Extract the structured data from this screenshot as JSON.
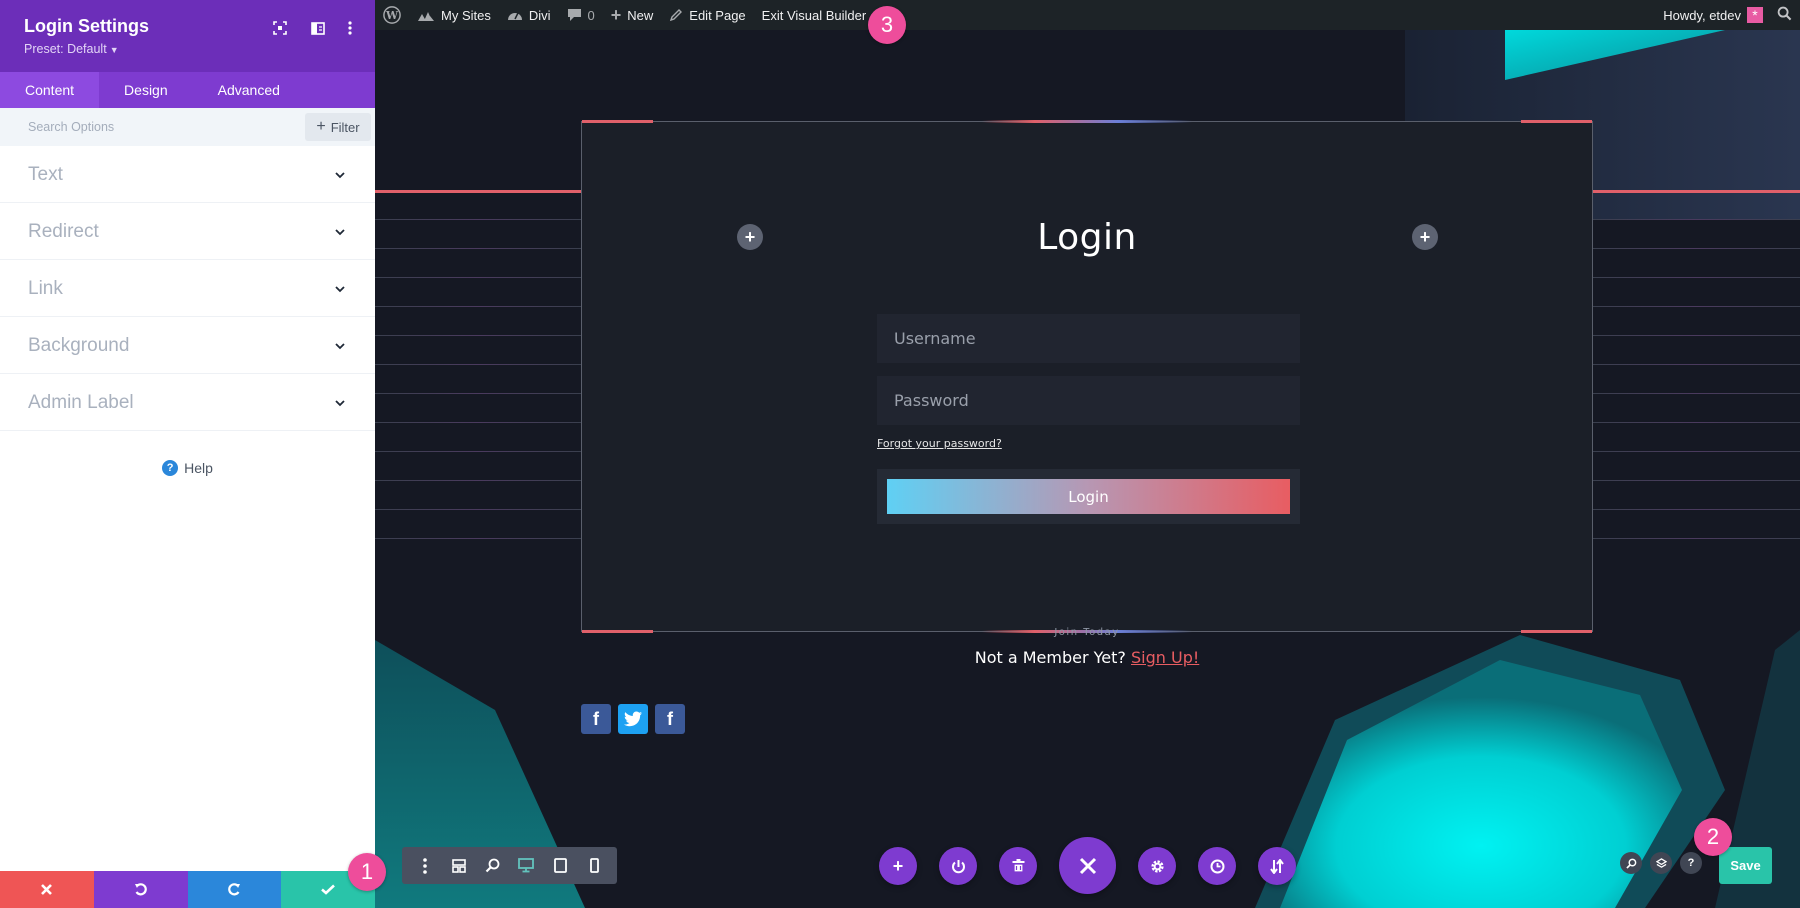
{
  "panel": {
    "title": "Login Settings",
    "preset": "Preset: Default",
    "tabs": [
      {
        "label": "Content",
        "active": true
      },
      {
        "label": "Design",
        "active": false
      },
      {
        "label": "Advanced",
        "active": false
      }
    ],
    "search_placeholder": "Search Options",
    "filter_label": "Filter",
    "toggles": [
      "Text",
      "Redirect",
      "Link",
      "Background",
      "Admin Label"
    ],
    "help_label": "Help",
    "footer_colors": {
      "discard": "#ef5555",
      "undo": "#7e3bd0",
      "redo": "#2b87da",
      "save": "#29c4a9"
    }
  },
  "adminbar": {
    "my_sites": "My Sites",
    "divi": "Divi",
    "comments_count": "0",
    "new": "New",
    "edit_page": "Edit Page",
    "exit_builder": "Exit Visual Builder",
    "howdy": "Howdy, etdev"
  },
  "login_module": {
    "title": "Login",
    "username_placeholder": "Username",
    "password_placeholder": "Password",
    "forgot_link": "Forgot your password?",
    "button_label": "Login"
  },
  "signup": {
    "kicker": "Join Today",
    "text": "Not a Member Yet?",
    "link": "Sign Up!"
  },
  "socials": [
    {
      "network": "facebook",
      "glyph": "f",
      "color": "#3b5998"
    },
    {
      "network": "twitter",
      "glyph": "t",
      "color": "#00aced"
    },
    {
      "network": "facebook",
      "glyph": "f",
      "color": "#3b5998"
    }
  ],
  "save_button": "Save",
  "badges": {
    "one": "1",
    "two": "2",
    "three": "3"
  },
  "colors": {
    "accent_purple": "#7e3bd0",
    "brand_red": "#e0606a",
    "teal": "#29c4a9",
    "badge_pink": "#ee4d9b"
  }
}
